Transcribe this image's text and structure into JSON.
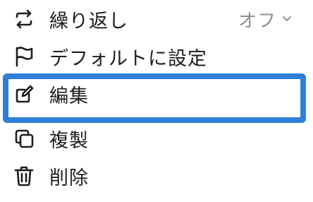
{
  "menu": {
    "items": [
      {
        "label": "繰り返し",
        "icon": "repeat-icon",
        "value": "オフ",
        "value_icon": "chevron-down-icon"
      },
      {
        "label": "デフォルトに設定",
        "icon": "flag-icon"
      },
      {
        "label": "編集",
        "icon": "edit-icon",
        "selected": true
      },
      {
        "label": "複製",
        "icon": "duplicate-icon"
      },
      {
        "label": "削除",
        "icon": "trash-icon"
      }
    ]
  },
  "colors": {
    "text": "#1d1d1f",
    "secondary_text": "#8e8e93",
    "selection_border": "#2f7fd8",
    "background": "#ffffff"
  }
}
